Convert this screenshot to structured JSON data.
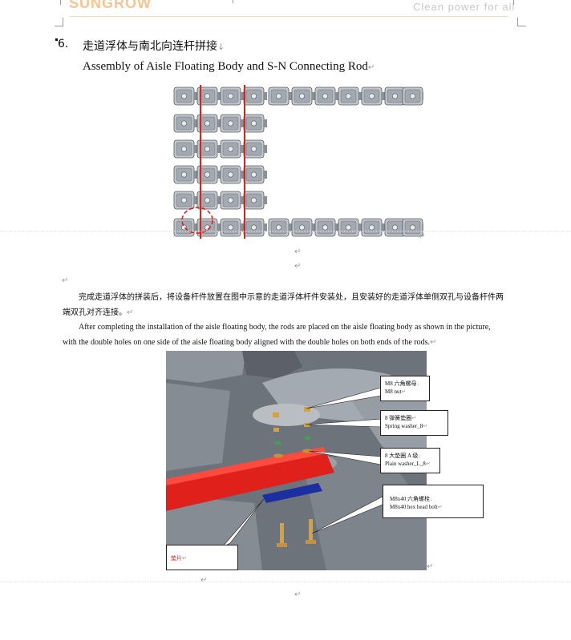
{
  "header": {
    "logo": "SUNGROW",
    "slogan": "Clean power for all"
  },
  "section": {
    "number": "6.",
    "title_cn": "走道浮体与南北向连杆拼接",
    "title_en": "Assembly of Aisle Floating Body and S-N Connecting Rod"
  },
  "body": {
    "para_cn_line1": "完成走道浮体的拼装后，将设备杆件放置在图中示意的走道浮体杆件安装处，且安装好的走道浮体单侧双孔与设备杆件两",
    "para_cn_line2": "端双孔对齐连接。",
    "para_en_line1": "After completing the installation of the aisle floating body, the rods are placed on the aisle floating body as shown in the picture,",
    "para_en_line2": "with the double holes on one side of the aisle floating body aligned with the double holes on both ends of the rods."
  },
  "callouts": {
    "nut_cn": "M8 六角螺母",
    "nut_en": "M8 nut",
    "spring_cn": "8 弹簧垫圈",
    "spring_en": "Spring washer_8",
    "plain_cn": "8 大垫圈 A 级",
    "plain_en": "Plain washer_L_8",
    "bolt_cn": "M8x40 六角螺栓",
    "bolt_en": "M8x40 hex head bolt",
    "pad_cn": "垫片"
  },
  "marks": {
    "return": "↵",
    "arrow_down": "↓"
  },
  "colors": {
    "rod_red": "#e0201b",
    "float_gray": "#9aa1a8",
    "float_light": "#c2c7cc",
    "render_gray": "#6d737b",
    "bolt_gold": "#d9a13a",
    "washer_green": "#3fa34a",
    "pad_blue": "#1b2fa0",
    "logo_orange": "#f6c48e"
  },
  "icons": {
    "para_mark": "pilcrow-return-icon",
    "bullet": "heading-bullet-icon"
  }
}
